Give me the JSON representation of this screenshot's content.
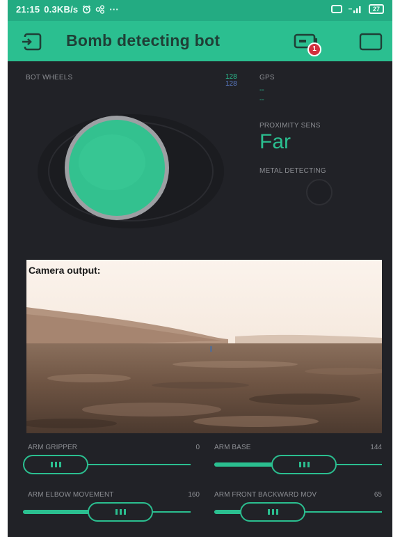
{
  "status_bar": {
    "time": "21:15",
    "speed": "0.3KB/s",
    "more": "···",
    "battery": "27"
  },
  "app": {
    "title": "Bomb detecting bot",
    "notification_count": "1"
  },
  "widgets": {
    "joystick": {
      "label": "BOT WHEELS",
      "x": "128",
      "y": "128"
    },
    "gps": {
      "label": "GPS",
      "line1": "--",
      "line2": "--"
    },
    "proximity": {
      "label": "PROXIMITY SENS",
      "value": "Far"
    },
    "metal": {
      "label": "METAL DETECTING"
    },
    "camera": {
      "label": "Camera output:"
    }
  },
  "sliders": [
    {
      "label": "ARM GRIPPER",
      "value": "0",
      "fraction": 0
    },
    {
      "label": "ARM BASE",
      "value": "144",
      "fraction": 0.56
    },
    {
      "label": "ARM ELBOW MOVEMENT",
      "value": "160",
      "fraction": 0.63
    },
    {
      "label": "ARM FRONT BACKWARD MOV",
      "value": "65",
      "fraction": 0.25
    }
  ],
  "colors": {
    "accent": "#2bbf90",
    "background": "#212227",
    "joystick_x": "#2bbf90",
    "joystick_y": "#5c7cc8"
  }
}
